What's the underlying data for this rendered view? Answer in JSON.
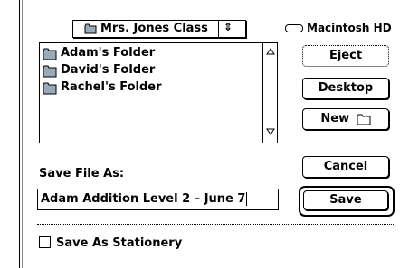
{
  "folder_popup": {
    "label": "Mrs. Jones Class",
    "arrows": "⇕"
  },
  "volume": {
    "label": "Macintosh HD"
  },
  "file_list": {
    "items": [
      {
        "label": "Adam's Folder"
      },
      {
        "label": "David's Folder"
      },
      {
        "label": "Rachel's Folder"
      }
    ]
  },
  "buttons": {
    "eject": "Eject",
    "desktop": "Desktop",
    "new": "New",
    "cancel": "Cancel",
    "save": "Save"
  },
  "save_as": {
    "label": "Save File As:",
    "value": "Adam Addition Level 2 – June 7"
  },
  "stationery": {
    "label": "Save As Stationery",
    "checked": false
  }
}
